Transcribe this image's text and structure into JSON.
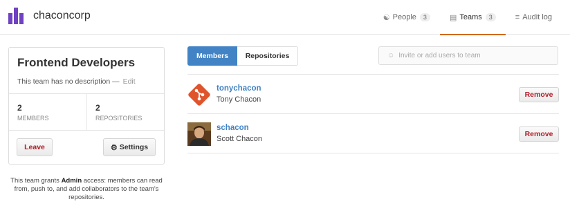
{
  "header": {
    "org_name": "chaconcorp",
    "nav": [
      {
        "label": "People",
        "count": "3",
        "icon": "org-icon"
      },
      {
        "label": "Teams",
        "count": "3",
        "icon": "jersey-icon"
      },
      {
        "label": "Audit log",
        "icon": "list-icon"
      }
    ]
  },
  "team": {
    "name": "Frontend Developers",
    "description": "This team has no description",
    "description_sep": "—",
    "edit_label": "Edit",
    "members_count": "2",
    "members_label": "MEMBERS",
    "repos_count": "2",
    "repos_label": "REPOSITORIES",
    "leave_label": "Leave",
    "settings_label": "Settings"
  },
  "grant": {
    "prefix": "This team grants",
    "level": "Admin",
    "suffix": "access: members can read from, push to, and add collaborators to the team's repositories."
  },
  "tabs": {
    "members": "Members",
    "repositories": "Repositories"
  },
  "invite": {
    "placeholder": "Invite or add users to team"
  },
  "members": [
    {
      "username": "tonychacon",
      "full_name": "Tony Chacon",
      "remove_label": "Remove"
    },
    {
      "username": "schacon",
      "full_name": "Scott Chacon",
      "remove_label": "Remove"
    }
  ],
  "colors": {
    "accent_blue": "#4183c4",
    "danger_red": "#b31d28",
    "active_underline": "#d26911",
    "logo_purple": "#6f42c1"
  }
}
